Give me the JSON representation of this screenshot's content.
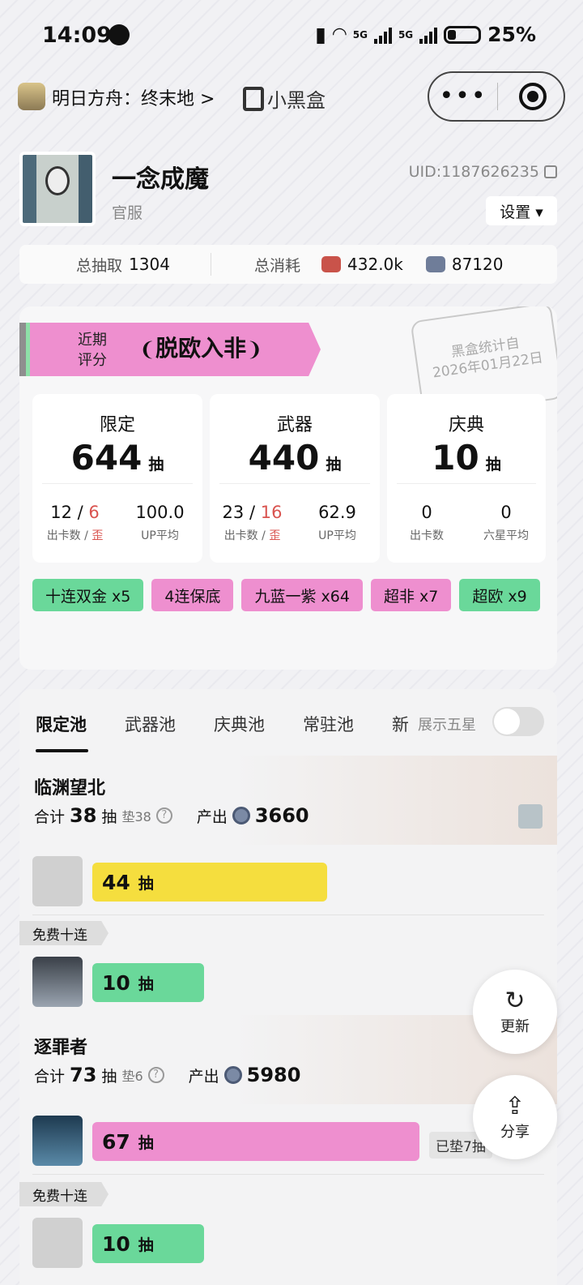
{
  "status": {
    "time": "14:09",
    "battery": "25%",
    "net1": "5G",
    "net2": "5G"
  },
  "nav": {
    "title": "明日方舟：终末地 >",
    "brand": "小黑盒"
  },
  "profile": {
    "name": "一念成魔",
    "server": "官服",
    "uid": "UID:1187626235",
    "settings": "设置 ▾"
  },
  "totals": {
    "draw_label": "总抽取",
    "draw_value": "1304",
    "cost_label": "总消耗",
    "cost_a": "432.0k",
    "cost_b": "87120"
  },
  "score": {
    "label1": "近期",
    "label2": "评分",
    "title": "脱欧入非",
    "stamp1": "黑盒统计自",
    "stamp2": "2026年01月22日"
  },
  "stats": [
    {
      "name": "限定",
      "count": "644",
      "unit": "抽",
      "a": "12",
      "sep": " / ",
      "a2": "6",
      "al": "出卡数",
      "al2": "歪",
      "b": "100.0",
      "bl": "UP平均"
    },
    {
      "name": "武器",
      "count": "440",
      "unit": "抽",
      "a": "23",
      "sep": " / ",
      "a2": "16",
      "al": "出卡数",
      "al2": "歪",
      "b": "62.9",
      "bl": "UP平均"
    },
    {
      "name": "庆典",
      "count": "10",
      "unit": "抽",
      "a": "0",
      "sep": "",
      "a2": "",
      "al": "出卡数",
      "al2": "",
      "b": "0",
      "bl": "六星平均"
    }
  ],
  "tags": [
    {
      "text": "十连双金 x5",
      "color": "green"
    },
    {
      "text": "4连保底",
      "color": "pink"
    },
    {
      "text": "九蓝一紫 x64",
      "color": "pink"
    },
    {
      "text": "超非 x7",
      "color": "pink"
    },
    {
      "text": "超欧 x9",
      "color": "green"
    }
  ],
  "tabs": [
    "限定池",
    "武器池",
    "庆典池",
    "常驻池",
    "新"
  ],
  "show_five": "展示五星",
  "banners": [
    {
      "name": "临渊望北",
      "total_label": "合计",
      "total": "38",
      "unit": "抽",
      "pad": "垫38",
      "out_label": "产出",
      "out": "3660"
    },
    {
      "name": "逐罪者",
      "total_label": "合计",
      "total": "73",
      "unit": "抽",
      "pad": "垫6",
      "out_label": "产出",
      "out": "5980"
    }
  ],
  "rows": [
    {
      "count": "44",
      "unit": "抽"
    },
    {
      "count": "10",
      "unit": "抽"
    },
    {
      "count": "67",
      "unit": "抽",
      "pad": "已垫7抽"
    },
    {
      "count": "10",
      "unit": "抽"
    }
  ],
  "free_label": "免费十连",
  "fab": {
    "refresh": "更新",
    "share": "分享"
  }
}
